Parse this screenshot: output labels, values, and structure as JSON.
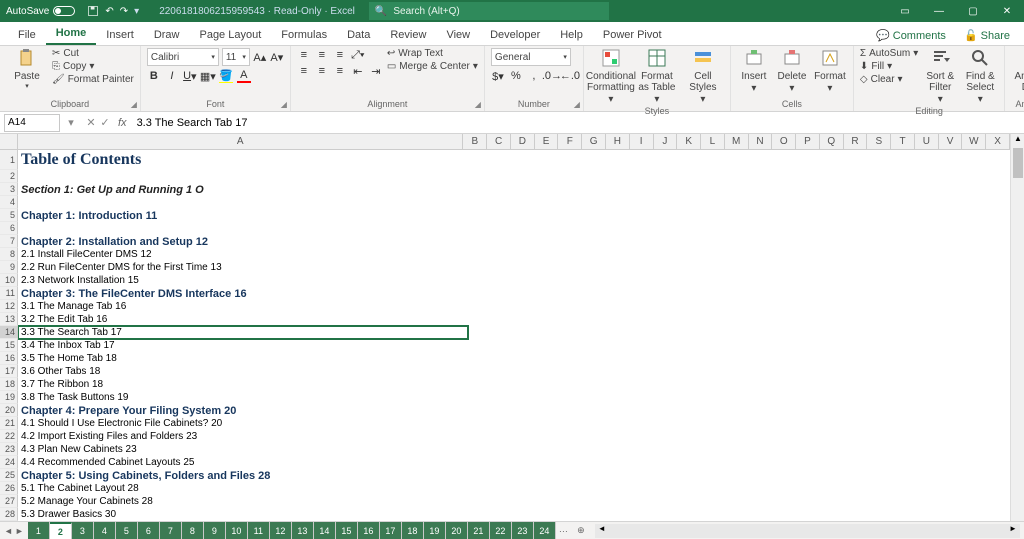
{
  "titlebar": {
    "autosave": "AutoSave",
    "doctitle": "2206181806215959543 · Read-Only · Excel",
    "search_placeholder": "Search (Alt+Q)"
  },
  "tabs": {
    "file": "File",
    "home": "Home",
    "insert": "Insert",
    "draw": "Draw",
    "pagelayout": "Page Layout",
    "formulas": "Formulas",
    "data": "Data",
    "review": "Review",
    "view": "View",
    "developer": "Developer",
    "help": "Help",
    "powerpivot": "Power Pivot",
    "comments": "Comments",
    "share": "Share"
  },
  "ribbon": {
    "paste": "Paste",
    "cut": "Cut",
    "copy": "Copy",
    "fmtpainter": "Format Painter",
    "clipboard": "Clipboard",
    "fontname": "Calibri",
    "fontsize": "11",
    "font": "Font",
    "wraptext": "Wrap Text",
    "merge": "Merge & Center",
    "alignment": "Alignment",
    "numformat": "General",
    "number": "Number",
    "condformat": "Conditional Formatting",
    "formatastable": "Format as Table",
    "cellstyles": "Cell Styles",
    "styles": "Styles",
    "insert": "Insert",
    "delete": "Delete",
    "format": "Format",
    "cells": "Cells",
    "autosum": "AutoSum",
    "fill": "Fill",
    "clear": "Clear",
    "editing": "Editing",
    "sort": "Sort & Filter",
    "find": "Find & Select",
    "analyze": "Analyze Data",
    "analysis": "Analysis"
  },
  "fbar": {
    "cell": "A14",
    "formula": "3.3 The Search Tab 17"
  },
  "cols": [
    "A",
    "B",
    "C",
    "D",
    "E",
    "F",
    "G",
    "H",
    "I",
    "J",
    "K",
    "L",
    "M",
    "N",
    "O",
    "P",
    "Q",
    "R",
    "S",
    "T",
    "U",
    "V",
    "W",
    "X"
  ],
  "rows": [
    {
      "n": 1,
      "text": "Table of Contents",
      "cls": "title-cell",
      "tall": true
    },
    {
      "n": 2,
      "text": "",
      "cls": ""
    },
    {
      "n": 3,
      "text": "Section 1: Get Up and Running 1 O",
      "cls": "section-cell"
    },
    {
      "n": 4,
      "text": "",
      "cls": ""
    },
    {
      "n": 5,
      "text": "Chapter 1: Introduction 11",
      "cls": "chapter-cell"
    },
    {
      "n": 6,
      "text": "",
      "cls": ""
    },
    {
      "n": 7,
      "text": "Chapter 2: Installation and Setup 12",
      "cls": "chapter-cell"
    },
    {
      "n": 8,
      "text": "2.1 Install FileCenter DMS 12",
      "cls": ""
    },
    {
      "n": 9,
      "text": "2.2 Run FileCenter DMS for the First Time 13",
      "cls": ""
    },
    {
      "n": 10,
      "text": "2.3 Network Installation 15",
      "cls": ""
    },
    {
      "n": 11,
      "text": "Chapter 3: The FileCenter DMS Interface 16",
      "cls": "chapter-cell"
    },
    {
      "n": 12,
      "text": "3.1 The Manage Tab 16",
      "cls": ""
    },
    {
      "n": 13,
      "text": "3.2 The Edit Tab 16",
      "cls": ""
    },
    {
      "n": 14,
      "text": "3.3 The Search Tab 17",
      "cls": "",
      "sel": true
    },
    {
      "n": 15,
      "text": "3.4 The Inbox Tab 17",
      "cls": ""
    },
    {
      "n": 16,
      "text": "3.5 The Home Tab 18",
      "cls": ""
    },
    {
      "n": 17,
      "text": "3.6 Other Tabs 18",
      "cls": ""
    },
    {
      "n": 18,
      "text": "3.7 The Ribbon 18",
      "cls": ""
    },
    {
      "n": 19,
      "text": "3.8 The Task Buttons 19",
      "cls": ""
    },
    {
      "n": 20,
      "text": "Chapter 4: Prepare Your Filing System 20",
      "cls": "chapter-cell"
    },
    {
      "n": 21,
      "text": "4.1 Should I Use Electronic File Cabinets? 20",
      "cls": ""
    },
    {
      "n": 22,
      "text": "4.2 Import Existing Files and Folders 23",
      "cls": ""
    },
    {
      "n": 23,
      "text": "4.3 Plan New Cabinets 23",
      "cls": ""
    },
    {
      "n": 24,
      "text": "4.4 Recommended Cabinet Layouts 25",
      "cls": ""
    },
    {
      "n": 25,
      "text": "Chapter 5: Using Cabinets, Folders and Files 28",
      "cls": "chapter-cell"
    },
    {
      "n": 26,
      "text": "5.1 The Cabinet Layout 28",
      "cls": ""
    },
    {
      "n": 27,
      "text": "5.2 Manage Your Cabinets 28",
      "cls": ""
    },
    {
      "n": 28,
      "text": "5.3 Drawer Basics 30",
      "cls": ""
    }
  ],
  "sheets": [
    "1",
    "2",
    "3",
    "4",
    "5",
    "6",
    "7",
    "8",
    "9",
    "10",
    "11",
    "12",
    "13",
    "14",
    "15",
    "16",
    "17",
    "18",
    "19",
    "20",
    "21",
    "22",
    "23",
    "24"
  ],
  "active_sheet": "2"
}
